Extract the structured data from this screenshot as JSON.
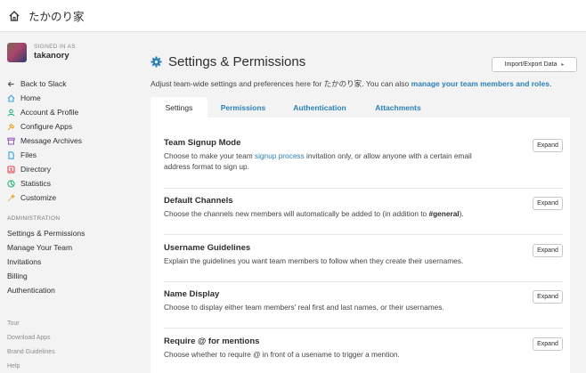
{
  "topbar": {
    "team_name": "たかのり家",
    "icon": "home-icon"
  },
  "user": {
    "signed_in_label": "SIGNED IN AS",
    "username": "takanory"
  },
  "nav": [
    {
      "label": "Back to Slack",
      "icon": "back-arrow-icon",
      "color": "#555555"
    },
    {
      "label": "Home",
      "icon": "home-icon",
      "color": "#3aa3e3"
    },
    {
      "label": "Account & Profile",
      "icon": "profile-icon",
      "color": "#2eb67d"
    },
    {
      "label": "Configure Apps",
      "icon": "apps-icon",
      "color": "#e8a723"
    },
    {
      "label": "Message Archives",
      "icon": "archive-icon",
      "color": "#9b59b6"
    },
    {
      "label": "Files",
      "icon": "files-icon",
      "color": "#3aa3e3"
    },
    {
      "label": "Directory",
      "icon": "directory-icon",
      "color": "#e0474a"
    },
    {
      "label": "Statistics",
      "icon": "statistics-icon",
      "color": "#2eb67d"
    },
    {
      "label": "Customize",
      "icon": "customize-icon",
      "color": "#e8a723"
    }
  ],
  "admin": {
    "heading": "ADMINISTRATION",
    "items": [
      "Settings & Permissions",
      "Manage Your Team",
      "Invitations",
      "Billing",
      "Authentication"
    ]
  },
  "footer": [
    "Tour",
    "Download Apps",
    "Brand Guidelines",
    "Help"
  ],
  "main": {
    "title": "Settings & Permissions",
    "import_button": "Import/Export Data",
    "subtitle_prefix": "Adjust team-wide settings and preferences here for ",
    "subtitle_team": "たかのり家",
    "subtitle_mid": ". You can also ",
    "subtitle_link": "manage your team members and roles",
    "subtitle_end": ".",
    "tabs": [
      "Settings",
      "Permissions",
      "Authentication",
      "Attachments"
    ],
    "active_tab": "Settings"
  },
  "sections": [
    {
      "title": "Team Signup Mode",
      "desc_a": "Choose to make your team ",
      "desc_link": "signup process",
      "desc_b": " invitation only, or allow anyone with a certain email address format to sign up.",
      "button": "Expand"
    },
    {
      "title": "Default Channels",
      "desc_a": "Choose the channels new members will automatically be added to (in addition to ",
      "desc_bold": "#general",
      "desc_b": ").",
      "button": "Expand"
    },
    {
      "title": "Username Guidelines",
      "desc": "Explain the guidelines you want team members to follow when they create their usernames.",
      "button": "Expand"
    },
    {
      "title": "Name Display",
      "desc": "Choose to display either team members' real first and last names, or their usernames.",
      "button": "Expand"
    },
    {
      "title": "Require @ for mentions",
      "desc": "Choose whether to require @ in front of a usename to trigger a mention.",
      "button": "Expand"
    }
  ],
  "colors": {
    "link": "#2a80b9",
    "background": "#f3f3f3",
    "panel": "#ffffff"
  }
}
